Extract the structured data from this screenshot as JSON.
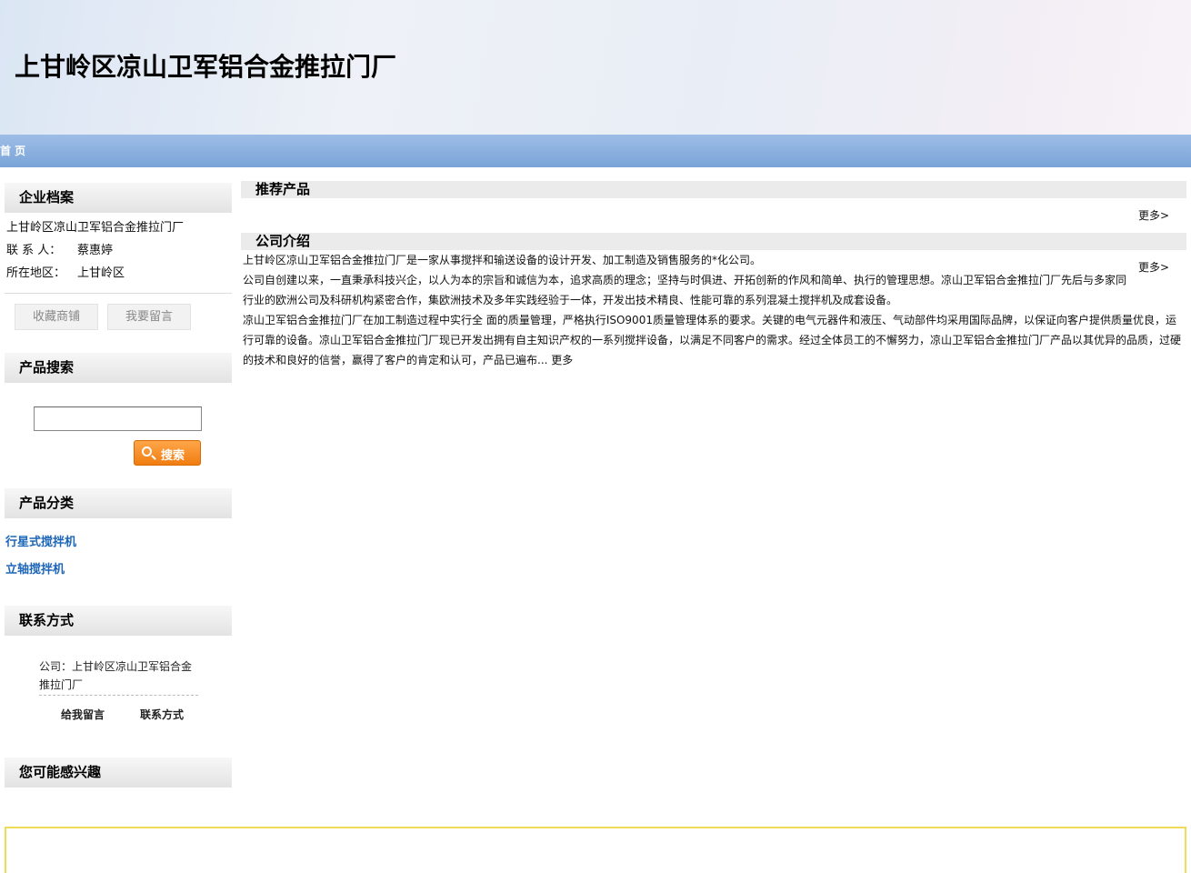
{
  "header": {
    "site_title": "上甘岭区凉山卫军铝合金推拉门厂"
  },
  "nav": {
    "home_label": "首 页"
  },
  "sidebar": {
    "profile": {
      "title": "企业档案",
      "company_name": "上甘岭区凉山卫军铝合金推拉门厂",
      "contact_label": "联 系 人：",
      "contact_value": "蔡惠婷",
      "region_label": "所在地区：",
      "region_value": "上甘岭区",
      "favorite_button": "收藏商铺",
      "message_button": "我要留言"
    },
    "search": {
      "title": "产品搜索",
      "input_value": "",
      "button_label": "搜索"
    },
    "categories": {
      "title": "产品分类",
      "items": [
        "行星式搅拌机",
        "立轴搅拌机"
      ]
    },
    "contact": {
      "title": "联系方式",
      "company_line": "公司：上甘岭区凉山卫军铝合金推拉门厂",
      "leave_message": "给我留言",
      "contact_info": "联系方式"
    },
    "interest": {
      "title": "您可能感兴趣"
    }
  },
  "main": {
    "recommended": {
      "title": "推荐产品",
      "more": "更多>"
    },
    "intro": {
      "title": "公司介绍",
      "more": "更多>",
      "paragraphs": [
        "上甘岭区凉山卫军铝合金推拉门厂是一家从事搅拌和输送设备的设计开发、加工制造及销售服务的*化公司。",
        "公司自创建以来，一直秉承科技兴企，以人为本的宗旨和诚信为本，追求高质的理念；坚持与时俱进、开拓创新的作风和简单、执行的管理思想。凉山卫军铝合金推拉门厂先后与多家同行业的欧洲公司及科研机构紧密合作，集欧洲技术及多年实践经验于一体，开发出技术精良、性能可靠的系列混凝土搅拌机及成套设备。",
        "凉山卫军铝合金推拉门厂在加工制造过程中实行全 面的质量管理，严格执行ISO9001质量管理体系的要求。关键的电气元器件和液压、气动部件均采用国际品牌，以保证向客户提供质量优良，运行可靠的设备。凉山卫军铝合金推拉门厂现已开发出拥有自主知识产权的一系列搅拌设备，以满足不同客户的需求。经过全体员工的不懈努力，凉山卫军铝合金推拉门厂产品以其优异的品质，过硬的技术和良好的信誉，赢得了客户的肯定和认可，产品已遍布..."
      ],
      "read_more": "更多"
    }
  },
  "colors": {
    "nav_blue": "#7aa4d8",
    "link_blue": "#1d66b8",
    "search_orange": "#f07d10",
    "footer_border": "#f1dc5a"
  }
}
